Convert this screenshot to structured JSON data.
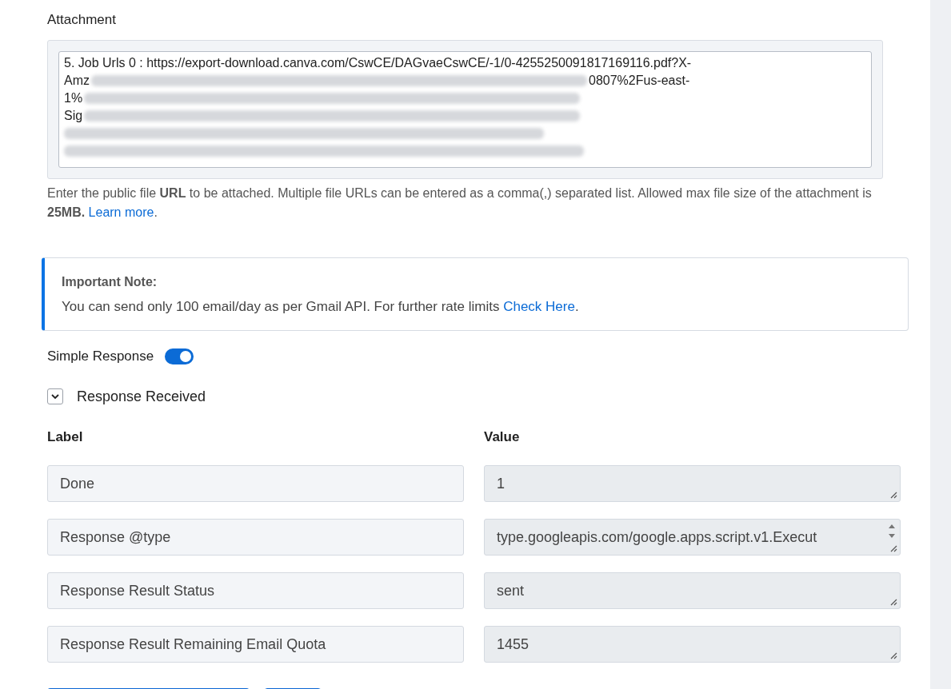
{
  "attachment": {
    "label": "Attachment",
    "first_line": "5. Job Urls 0 : https://export-download.canva.com/CswCE/DAGvaeCswCE/-1/0-4255250091817169116.pdf?X-",
    "fragments": [
      {
        "start": "Amz",
        "end": "0807%2Fus-east-"
      },
      {
        "start": "1%"
      },
      {
        "start": "Sig"
      }
    ],
    "help": "Enter the public file **URL** to be attached. Multiple file URLs can be entered as a comma(,) separated list. Allowed max file size of the attachment is **25MB.**",
    "help_link": "Learn more",
    "help_end": "."
  },
  "note": {
    "title": "Important Note:",
    "text": "You can send only 100 email/day as per Gmail API. For further rate limits",
    "link": "Check Here",
    "end": "."
  },
  "simple_response": {
    "label": "Simple Response",
    "on": true
  },
  "response_received": {
    "label": "Response Received",
    "expanded": true
  },
  "columns": [
    "Label",
    "Value"
  ],
  "rows": [
    {
      "label": "Done",
      "value": "1",
      "scroll": false
    },
    {
      "label": "Response @type",
      "value": "type.googleapis.com/google.apps.script.v1.Execut",
      "scroll": true
    },
    {
      "label": "Response Result Status",
      "value": "sent",
      "scroll": false
    },
    {
      "label": "Response Result Remaining Email Quota",
      "value": "1455",
      "scroll": false
    }
  ]
}
